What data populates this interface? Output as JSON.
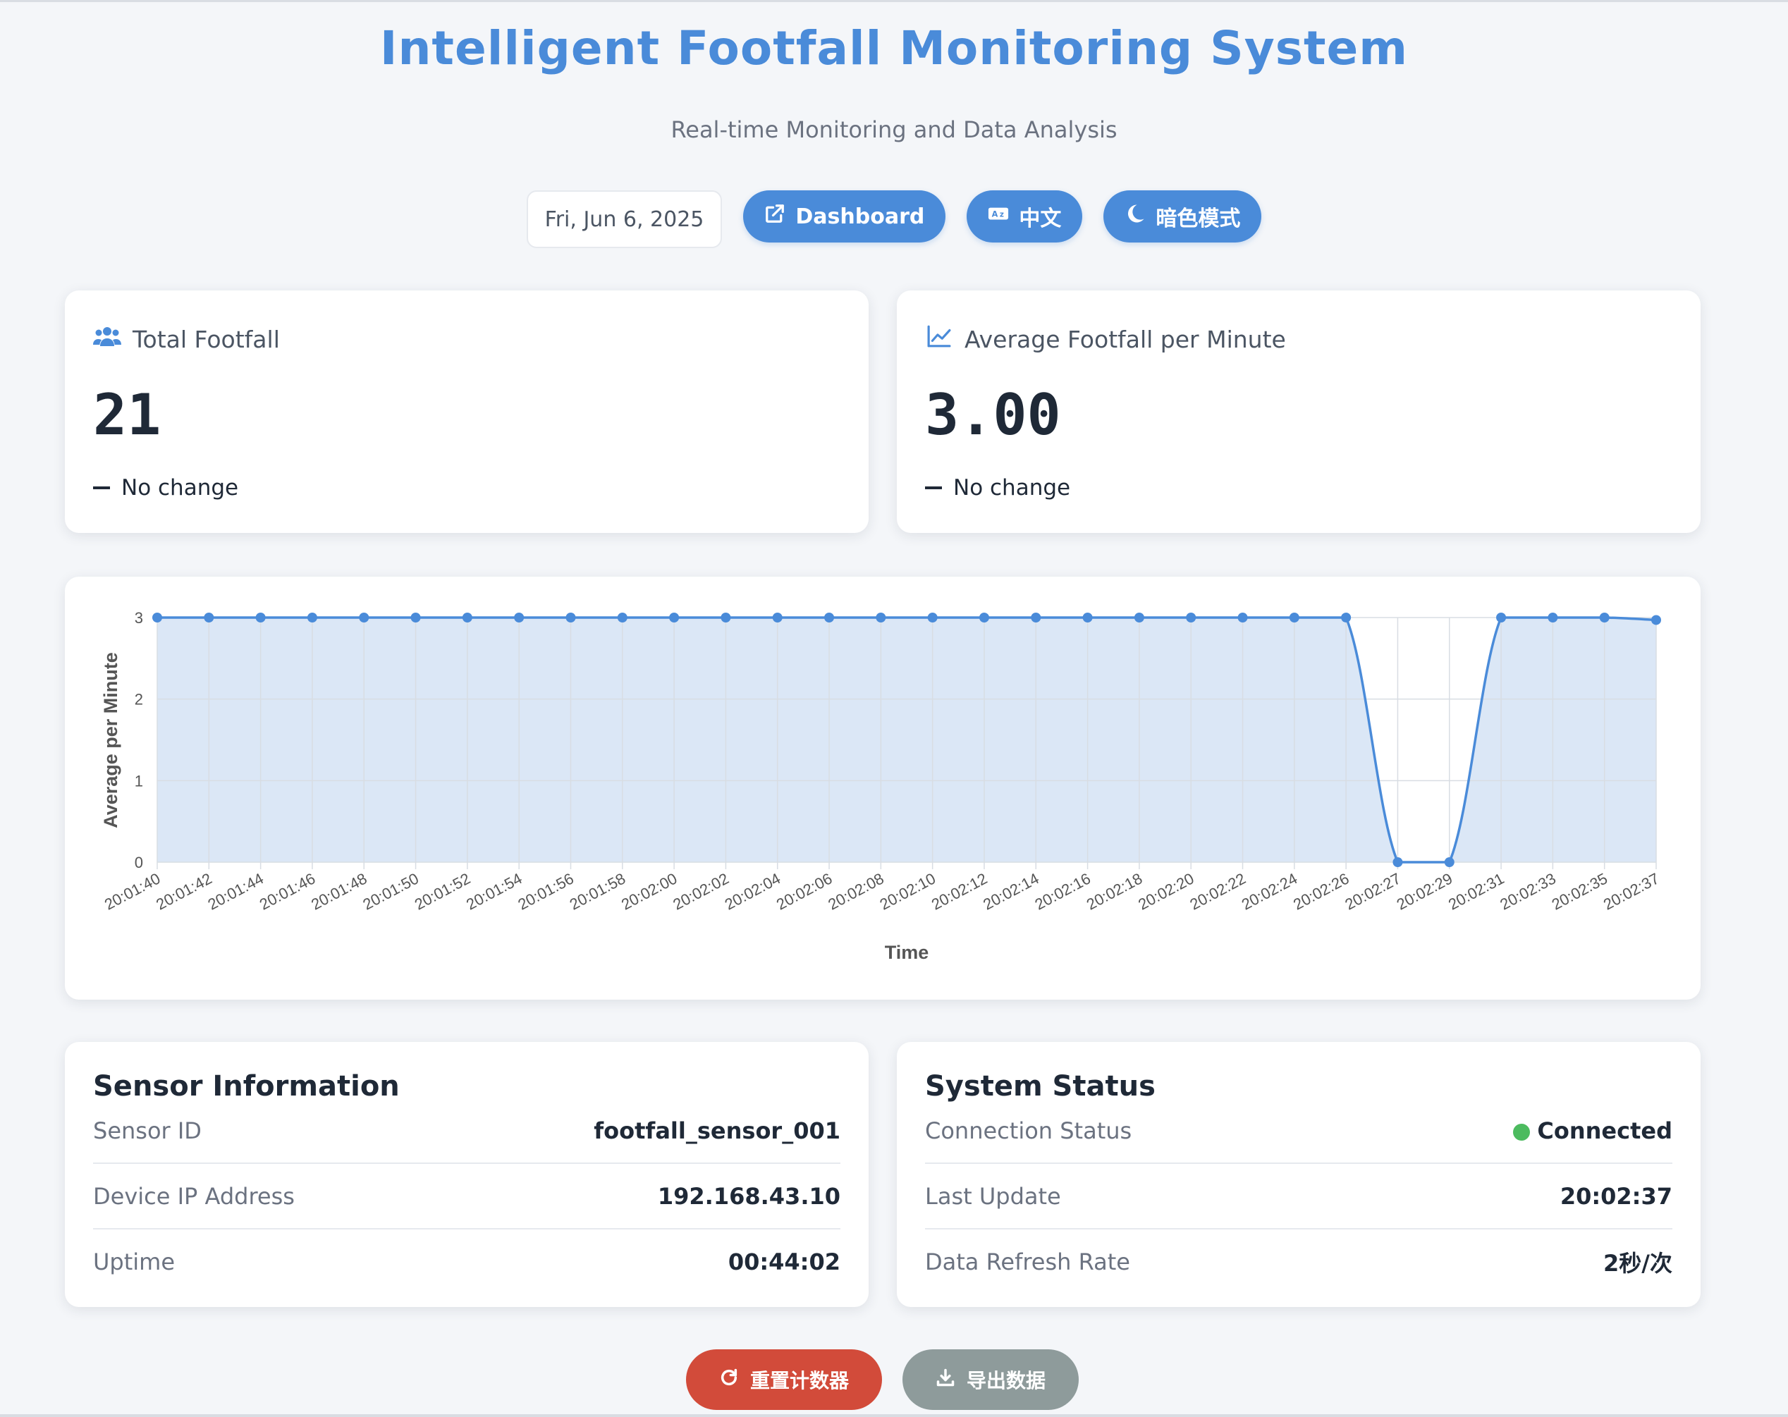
{
  "header": {
    "title": "Intelligent Footfall Monitoring System",
    "subtitle": "Real-time Monitoring and Data Analysis"
  },
  "controls": {
    "date": "Fri, Jun 6, 2025",
    "dashboard_label": "Dashboard",
    "language_label": "中文",
    "dark_mode_label": "暗色模式"
  },
  "stats": {
    "total": {
      "label": "Total Footfall",
      "value": "21",
      "change": "No change"
    },
    "average": {
      "label": "Average Footfall per Minute",
      "value": "3.00",
      "change": "No change"
    }
  },
  "chart_data": {
    "type": "area",
    "xlabel": "Time",
    "ylabel": "Average per Minute",
    "ylim": [
      0,
      3
    ],
    "yticks": [
      0,
      1,
      2,
      3
    ],
    "grid": true,
    "color": "#4a8bd9",
    "fill": "#dbe7f6",
    "x": [
      "20:01:40",
      "20:01:42",
      "20:01:44",
      "20:01:46",
      "20:01:48",
      "20:01:50",
      "20:01:52",
      "20:01:54",
      "20:01:56",
      "20:01:58",
      "20:02:00",
      "20:02:02",
      "20:02:04",
      "20:02:06",
      "20:02:08",
      "20:02:10",
      "20:02:12",
      "20:02:14",
      "20:02:16",
      "20:02:18",
      "20:02:20",
      "20:02:22",
      "20:02:24",
      "20:02:26",
      "20:02:27",
      "20:02:29",
      "20:02:31",
      "20:02:33",
      "20:02:35",
      "20:02:37"
    ],
    "series": [
      {
        "values": [
          3,
          3,
          3,
          3,
          3,
          3,
          3,
          3,
          3,
          3,
          3,
          3,
          3,
          3,
          3,
          3,
          3,
          3,
          3,
          3,
          3,
          3,
          3,
          3,
          0,
          0,
          3,
          3,
          3,
          2.97
        ]
      }
    ]
  },
  "sensor": {
    "title": "Sensor Information",
    "rows": [
      {
        "label": "Sensor ID",
        "value": "footfall_sensor_001"
      },
      {
        "label": "Device IP Address",
        "value": "192.168.43.10"
      },
      {
        "label": "Uptime",
        "value": "00:44:02"
      }
    ]
  },
  "system": {
    "title": "System Status",
    "rows": [
      {
        "label": "Connection Status",
        "value": "Connected"
      },
      {
        "label": "Last Update",
        "value": "20:02:37"
      },
      {
        "label": "Data Refresh Rate",
        "value": "2秒/次"
      }
    ],
    "status_color": "#4cbb5f"
  },
  "actions": {
    "reset_label": "重置计数器",
    "export_label": "导出数据"
  }
}
